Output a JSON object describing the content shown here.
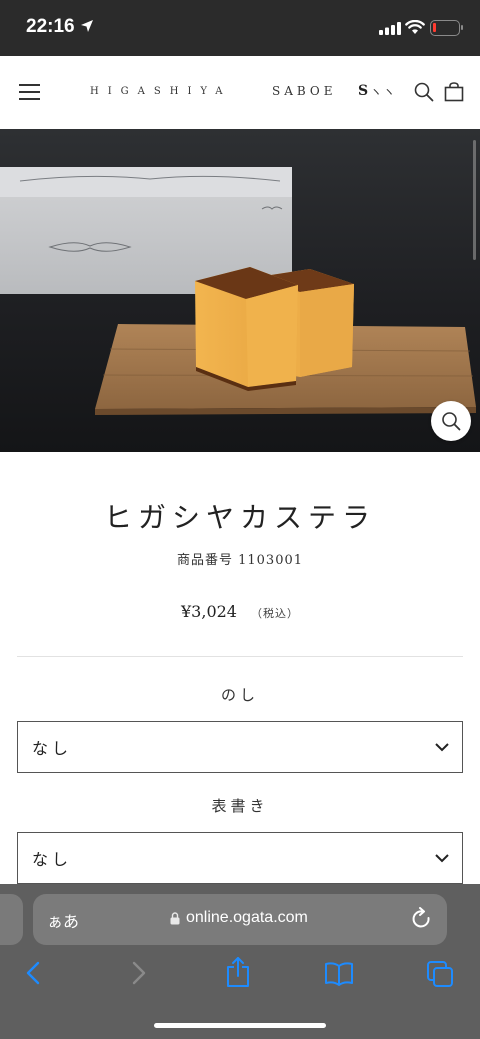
{
  "status_bar": {
    "time": "22:16",
    "battery_level": 0.12,
    "battery_color": "#ff3b30"
  },
  "header": {
    "menu_icon": "hamburger-icon",
    "brand_1": "HIGASHIYA",
    "brand_2": "SABOE",
    "brand_3": "S",
    "brand_3_marks": "ヽヽ",
    "search_icon": "search-icon",
    "cart_icon": "shopping-bag-icon"
  },
  "product": {
    "title": "ヒガシヤカステラ",
    "number": "商品番号 1103001",
    "price": "¥3,024",
    "tax_note": "（税込）",
    "zoom_icon": "zoom-icon"
  },
  "options": [
    {
      "label": "のし",
      "value": "なし"
    },
    {
      "label": "表書き",
      "value": "なし"
    }
  ],
  "browser": {
    "aa_label": "ぁあ",
    "url": "online.ogata.com",
    "reload_icon": "reload-icon",
    "toolbar": [
      "back-icon",
      "forward-icon",
      "share-icon",
      "bookmarks-icon",
      "tabs-icon"
    ],
    "accent_color": "#1d8bff"
  }
}
